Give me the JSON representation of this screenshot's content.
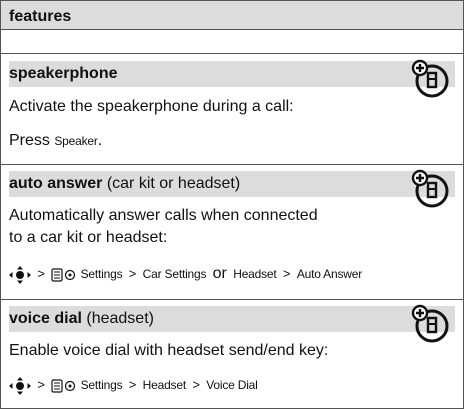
{
  "header": {
    "title": "features"
  },
  "sections": [
    {
      "title": "speakerphone",
      "title_suffix": "",
      "desc": "Activate the speakerphone during a call:",
      "action_prefix": "Press",
      "action_key": "Speaker",
      "action_end": "."
    },
    {
      "title": "auto answer",
      "title_suffix": "(car kit or headset)",
      "desc_line1": "Automatically answer calls when connected",
      "desc_line2": "to a car kit or headset:",
      "path": {
        "gt": ">",
        "settings": "Settings",
        "car_settings": "Car Settings",
        "or": "or",
        "headset": "Headset",
        "auto_answer": "Auto Answer"
      }
    },
    {
      "title": "voice dial",
      "title_suffix": "(headset)",
      "desc": "Enable voice dial with headset send/end key:",
      "path": {
        "gt": ">",
        "settings": "Settings",
        "headset": "Headset",
        "voice_dial": "Voice Dial"
      }
    }
  ],
  "icons": {
    "feature_icon": "network-feature-icon",
    "nav_key": "nav-key-icon",
    "settings": "settings-icon"
  }
}
